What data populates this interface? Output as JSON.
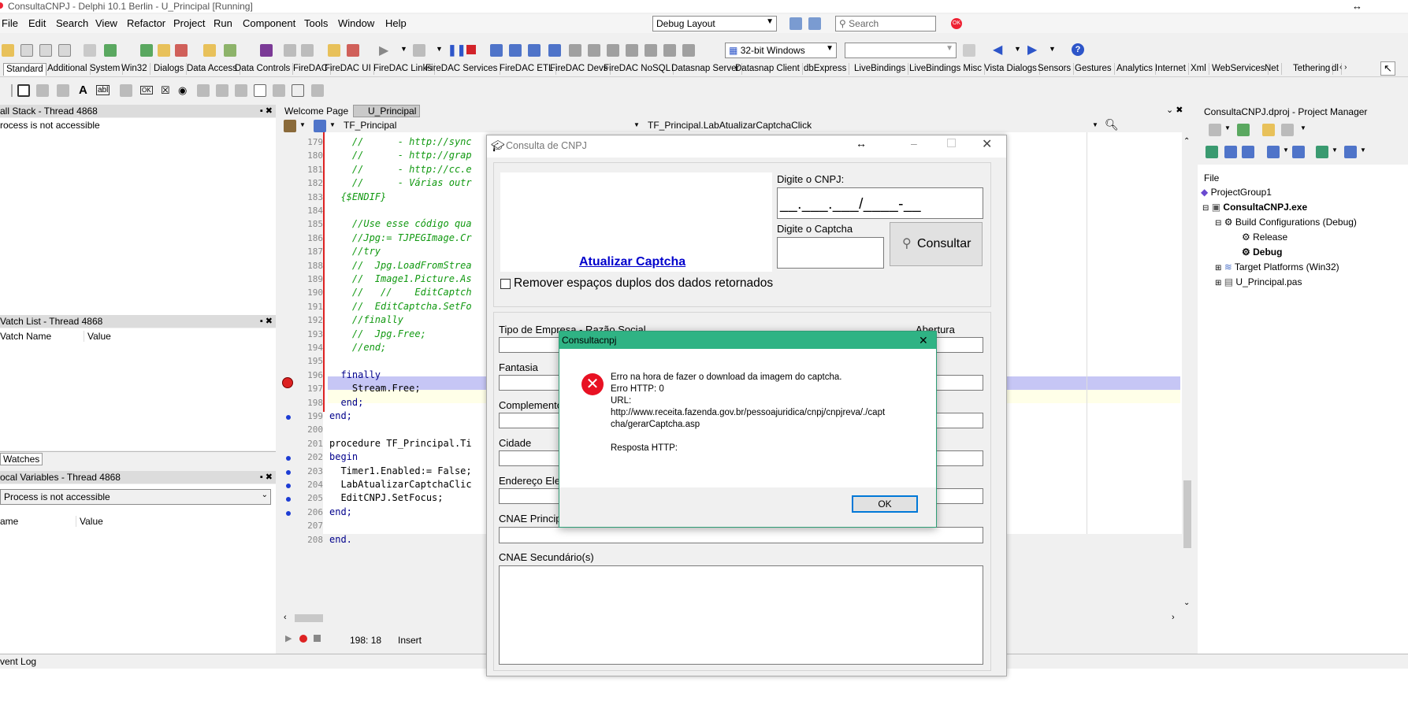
{
  "titlebar": {
    "title": "ConsultaCNPJ - Delphi 10.1 Berlin - U_Principal [Running]"
  },
  "menu": [
    {
      "label": "File"
    },
    {
      "label": "Edit"
    },
    {
      "label": "Search"
    },
    {
      "label": "View"
    },
    {
      "label": "Refactor"
    },
    {
      "label": "Project"
    },
    {
      "label": "Run"
    },
    {
      "label": "Component"
    },
    {
      "label": "Tools"
    },
    {
      "label": "Window"
    },
    {
      "label": "Help"
    }
  ],
  "toolbar": {
    "layout_combo": "Debug Layout",
    "search_placeholder": "Search",
    "platform_combo": "32-bit Windows",
    "config_combo": ""
  },
  "palette_tabs": [
    "Standard",
    "Additional",
    "System",
    "Win32",
    "Dialogs",
    "Data Access",
    "Data Controls",
    "FireDAC",
    "FireDAC UI",
    "FireDAC Links",
    "FireDAC Services",
    "FireDAC ETL",
    "FireDAC Devs",
    "FireDAC NoSQL",
    "Datasnap Server",
    "Datasnap Client",
    "dbExpress",
    "LiveBindings",
    "LiveBindings Misc",
    "Vista Dialogs",
    "Sensors",
    "Gestures",
    "Analytics",
    "Internet",
    "Xml",
    "WebServices",
    "Net",
    "Tethering",
    "dl"
  ],
  "call_stack": {
    "title": "all Stack - Thread 4868",
    "message": "rocess is not accessible"
  },
  "watch_list": {
    "title": "Vatch List - Thread 4868",
    "col_name": "Vatch Name",
    "col_value": "Value",
    "tab": "Watches"
  },
  "local_vars": {
    "title": "ocal Variables - Thread 4868",
    "combo": "Process is not accessible",
    "col_name": "ame",
    "col_value": "Value"
  },
  "event_log": "vent Log",
  "editor": {
    "tabs": [
      "Welcome Page",
      "U_Principal"
    ],
    "class_combo": "TF_Principal",
    "method_combo": "TF_Principal.LabAtualizarCaptchaClick",
    "lines": [
      {
        "n": "179",
        "t": "    //      - http://sync",
        "c": "cm"
      },
      {
        "n": "180",
        "t": "    //      - http://grap",
        "c": "cm"
      },
      {
        "n": "181",
        "t": "    //      - http://cc.e",
        "c": "cm"
      },
      {
        "n": "182",
        "t": "    //      - Várias outr",
        "c": "cm"
      },
      {
        "n": "183",
        "t": "  {$ENDIF}",
        "c": "cm"
      },
      {
        "n": "184",
        "t": "",
        "c": ""
      },
      {
        "n": "185",
        "t": "    //Use esse código qua",
        "c": "cm"
      },
      {
        "n": "186",
        "t": "    //Jpg:= TJPEGImage.Cr",
        "c": "cm"
      },
      {
        "n": "187",
        "t": "    //try",
        "c": "cm"
      },
      {
        "n": "188",
        "t": "    //  Jpg.LoadFromStrea",
        "c": "cm"
      },
      {
        "n": "189",
        "t": "    //  Image1.Picture.As",
        "c": "cm"
      },
      {
        "n": "190",
        "t": "    //   //    EditCaptch",
        "c": "cm"
      },
      {
        "n": "191",
        "t": "    //  EditCaptcha.SetFo",
        "c": "cm"
      },
      {
        "n": "192",
        "t": "    //finally",
        "c": "cm"
      },
      {
        "n": "193",
        "t": "    //  Jpg.Free;",
        "c": "cm"
      },
      {
        "n": "194",
        "t": "    //end;",
        "c": "cm"
      },
      {
        "n": "195",
        "t": "",
        "c": ""
      },
      {
        "n": "196",
        "t": "  finally",
        "c": "kw2"
      },
      {
        "n": "197",
        "t": "    Stream.Free;",
        "c": ""
      },
      {
        "n": "198",
        "t": "  end;",
        "c": "kw2"
      },
      {
        "n": "199",
        "t": "end;",
        "c": "kw2"
      },
      {
        "n": "200",
        "t": "",
        "c": ""
      },
      {
        "n": "201",
        "t": "procedure TF_Principal.Ti",
        "c": ""
      },
      {
        "n": "202",
        "t": "begin",
        "c": "kw2"
      },
      {
        "n": "203",
        "t": "  Timer1.Enabled:= False;",
        "c": ""
      },
      {
        "n": "204",
        "t": "  LabAtualizarCaptchaClic",
        "c": ""
      },
      {
        "n": "205",
        "t": "  EditCNPJ.SetFocus;",
        "c": ""
      },
      {
        "n": "206",
        "t": "end;",
        "c": "kw2"
      },
      {
        "n": "207",
        "t": "",
        "c": ""
      },
      {
        "n": "208",
        "t": "end.",
        "c": "kw2"
      }
    ],
    "cursor_pos": "198: 18",
    "mode": "Insert"
  },
  "form": {
    "title": "Consulta de CNPJ",
    "captcha_link": "Atualizar Captcha",
    "cnpj_label": "Digite o CNPJ:",
    "cnpj_mask": "__.___.___/____-__",
    "captcha_label": "Digite o Captcha",
    "consult_button": "Consultar",
    "checkbox_label": "Remover espaços duplos dos dados retornados",
    "f_tipo": "Tipo de Empresa - Razão Social",
    "f_abertura": "Abertura",
    "f_fantasia": "Fantasia",
    "f_complemento": "Complemento",
    "f_cidade": "Cidade",
    "f_endereco": "Endereço Ele",
    "f_cnae": "CNAE Princip",
    "f_cnae2": "CNAE Secundário(s)"
  },
  "dialog": {
    "title": "Consultacnpj",
    "line1": "Erro na hora de fazer o download da imagem do captcha.",
    "line2": "Erro HTTP: 0",
    "line3": "URL:",
    "line4": "http://www.receita.fazenda.gov.br/pessoajuridica/cnpj/cnpjreva/./capt",
    "line5": "cha/gerarCaptcha.asp",
    "line6": "Resposta HTTP:",
    "ok": "OK"
  },
  "project_manager": {
    "title": "ConsultaCNPJ.dproj - Project Manager",
    "file_header": "File",
    "items": [
      {
        "label": "ProjectGroup1",
        "bold": false
      },
      {
        "label": "ConsultaCNPJ.exe",
        "bold": true
      },
      {
        "label": "Build Configurations (Debug)",
        "bold": false
      },
      {
        "label": "Release",
        "bold": false
      },
      {
        "label": "Debug",
        "bold": true
      },
      {
        "label": "Target Platforms (Win32)",
        "bold": false
      },
      {
        "label": "U_Principal.pas",
        "bold": false
      }
    ]
  },
  "colors": {
    "dialog_header": "#2fb384",
    "error_icon": "#e81123",
    "exec_line": "#c6c6f5",
    "link": "#0000cc"
  }
}
